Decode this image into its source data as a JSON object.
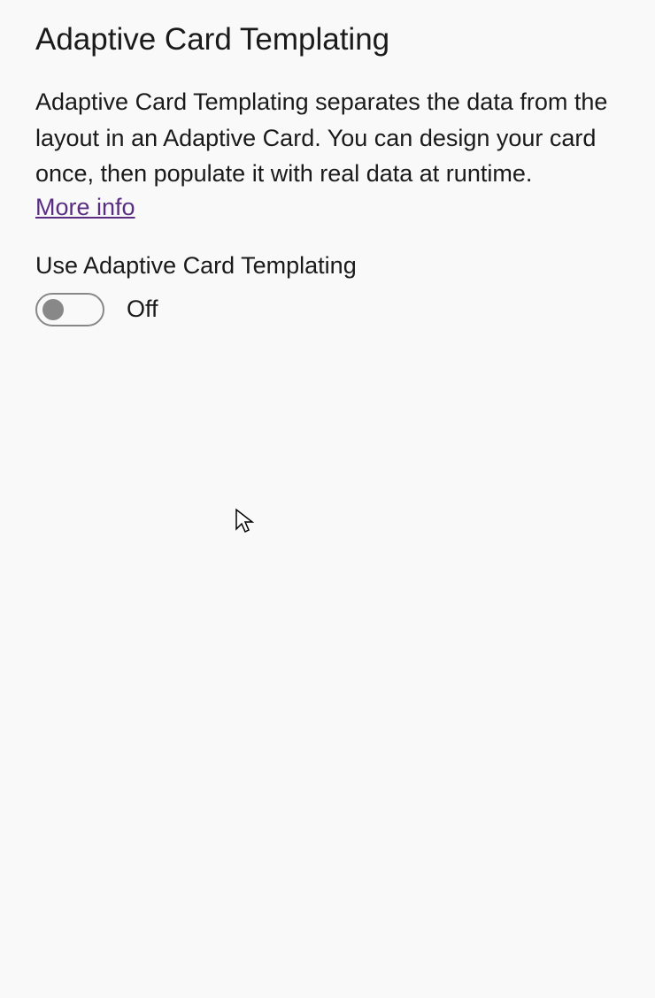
{
  "title": "Adaptive Card Templating",
  "description": "Adaptive Card Templating separates the data from the layout in an Adaptive Card. You can design your card once, then populate it with real data at runtime.",
  "more_info_label": "More info",
  "toggle": {
    "label": "Use Adaptive Card Templating",
    "state": "Off"
  }
}
